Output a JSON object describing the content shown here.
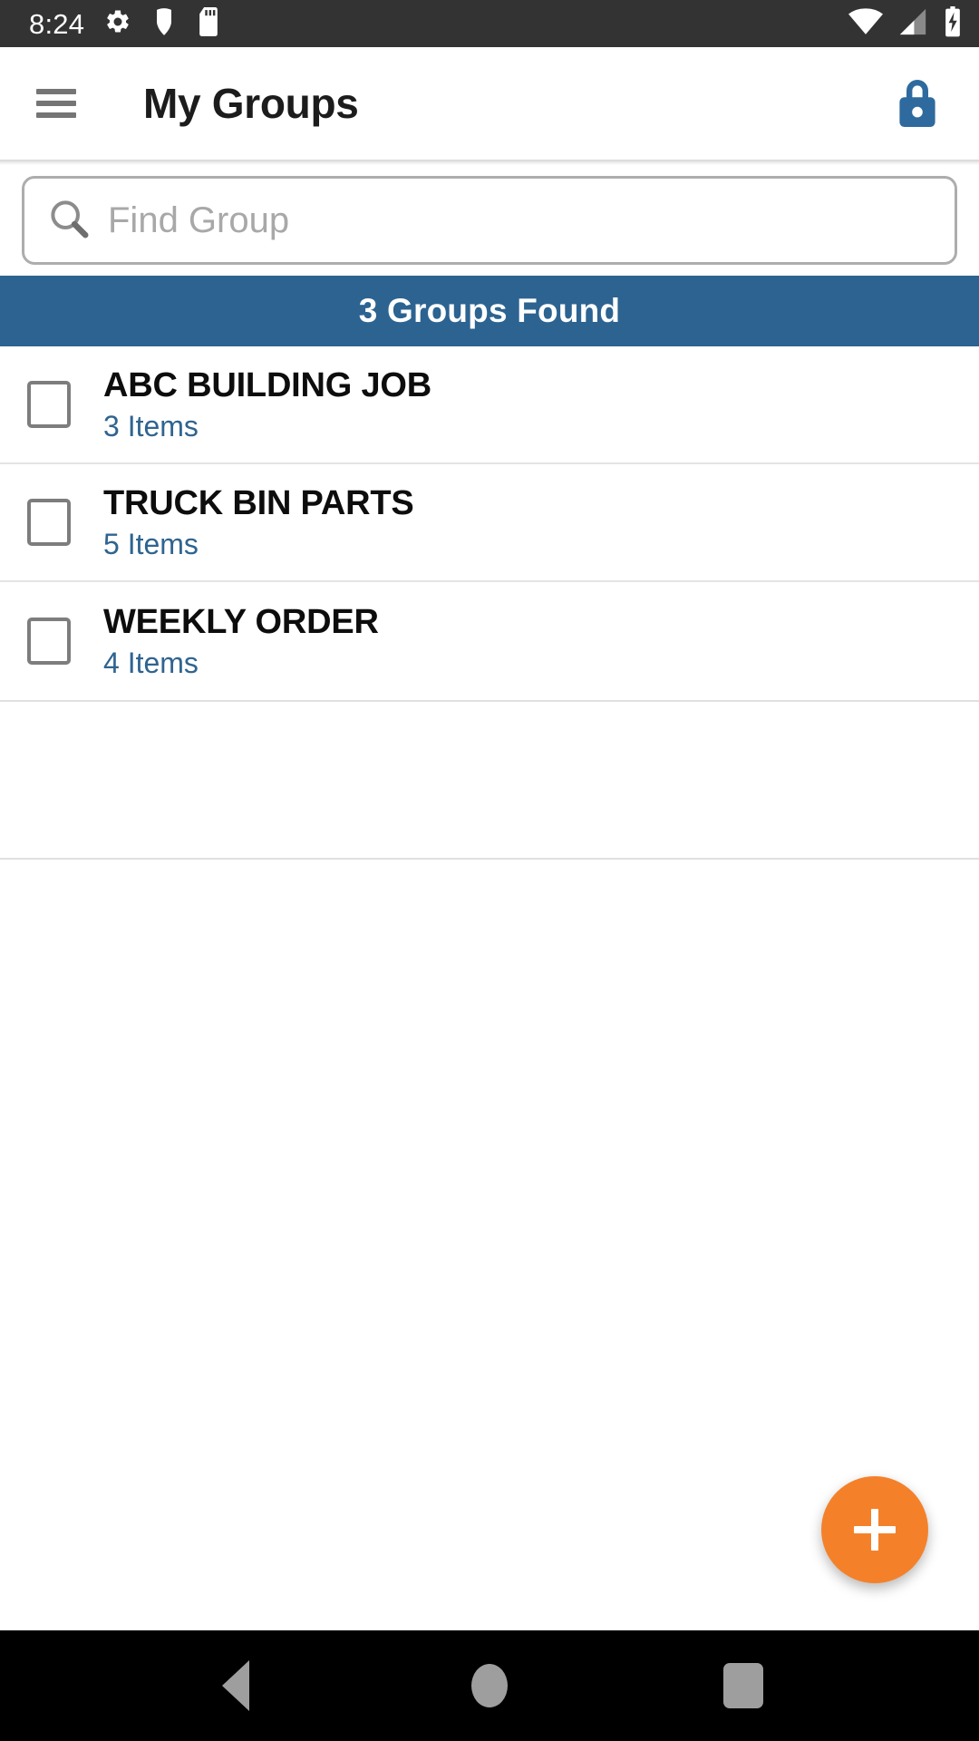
{
  "status_bar": {
    "time": "8:24",
    "left_icons": [
      "settings-gear-icon",
      "shield-icon",
      "sd-card-icon"
    ],
    "right_icons": [
      "wifi-icon",
      "cellular-signal-icon",
      "battery-charging-icon"
    ],
    "background_color": "#333333"
  },
  "app_bar": {
    "menu_icon": "hamburger-menu-icon",
    "title": "My Groups",
    "action_icon": "lock-icon",
    "lock_color": "#2e6a9e"
  },
  "search": {
    "icon": "magnifier-icon",
    "value": "",
    "placeholder": "Find Group"
  },
  "banner": {
    "text": "3 Groups Found",
    "background_color": "#2c6391",
    "text_color": "#ffffff"
  },
  "groups": [
    {
      "name": "ABC BUILDING JOB",
      "items": "3 Items",
      "checked": false
    },
    {
      "name": "TRUCK BIN PARTS",
      "items": "5 Items",
      "checked": false
    },
    {
      "name": "WEEKLY ORDER",
      "items": "4 Items",
      "checked": false
    }
  ],
  "fab": {
    "icon": "plus-icon",
    "label": "+",
    "color": "#f4812a"
  },
  "nav_bar": {
    "back": "back-triangle-icon",
    "home": "home-circle-icon",
    "recents": "recents-square-icon",
    "background_color": "#000000"
  }
}
